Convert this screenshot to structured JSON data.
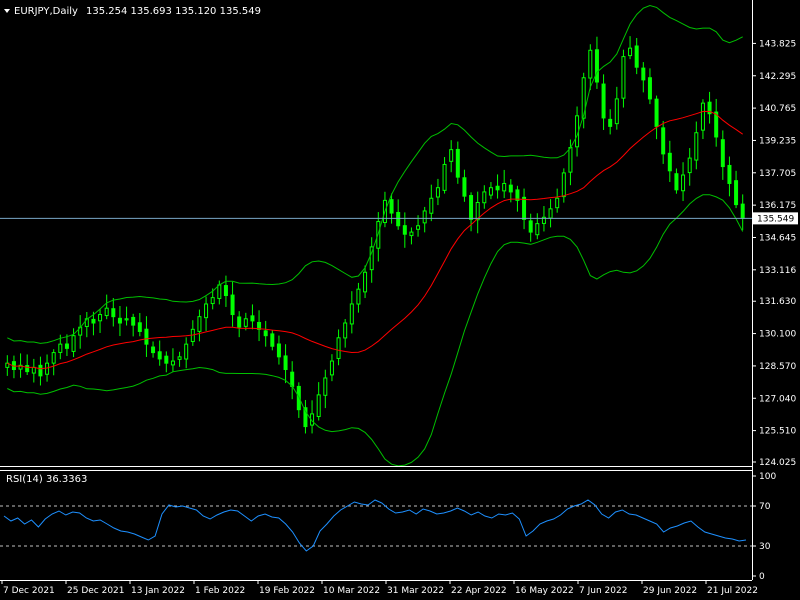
{
  "header": {
    "symbol": "EURJPY,Daily",
    "ohlc": "135.254 135.693 135.120 135.549"
  },
  "price_axis": {
    "ticks": [
      "143.825",
      "142.295",
      "140.765",
      "139.235",
      "137.705",
      "136.175",
      "134.645",
      "133.116",
      "131.630",
      "130.100",
      "128.570",
      "127.040",
      "125.510",
      "124.025"
    ],
    "current_price": "135.549"
  },
  "rsi": {
    "label": "RSI(14) 36.3363",
    "ticks": [
      "100",
      "70",
      "30",
      "0"
    ]
  },
  "time_axis": {
    "labels": [
      "7 Dec 2021",
      "25 Dec 2021",
      "13 Jan 2022",
      "1 Feb 2022",
      "19 Feb 2022",
      "10 Mar 2022",
      "31 Mar 2022",
      "22 Apr 2022",
      "16 May 2022",
      "7 Jun 2022",
      "29 Jun 2022",
      "21 Jul 2022"
    ]
  },
  "colors": {
    "background": "#000000",
    "candles": "#00ff00",
    "bands": "#00c000",
    "ma": "#ff0000",
    "rsi": "#1e90ff",
    "price_line": "#7aa7c7",
    "axis": "#ffffff"
  },
  "chart_data": {
    "type": "line",
    "title": "EURJPY,Daily",
    "series": [
      {
        "name": "EURJPY",
        "values": [
          128.7,
          128.4,
          128.6,
          128.3,
          128.5,
          128.1,
          128.7,
          129.2,
          129.6,
          129.4,
          130.0,
          130.4,
          130.8,
          130.6,
          131.0,
          131.3,
          130.9,
          130.6,
          130.8,
          130.5,
          130.2,
          129.6,
          129.2,
          128.9,
          128.7,
          128.8,
          129.0,
          129.6,
          130.3,
          130.9,
          131.5,
          131.8,
          132.4,
          131.9,
          131.0,
          130.4,
          130.8,
          130.7,
          130.3,
          130.0,
          129.5,
          129.0,
          128.4,
          127.6,
          126.5,
          125.7,
          126.3,
          127.2,
          128.0,
          128.8,
          129.9,
          130.6,
          131.5,
          132.2,
          133.0,
          134.2,
          135.4,
          136.4,
          135.8,
          135.2,
          134.8,
          134.9,
          135.2,
          135.9,
          136.5,
          137.0,
          138.1,
          138.8,
          137.5,
          136.6,
          135.5,
          136.3,
          136.8,
          137.0,
          136.9,
          137.2,
          136.8,
          136.4,
          135.5,
          134.9,
          135.3,
          135.6,
          136.0,
          136.5,
          137.7,
          138.9,
          140.4,
          142.2,
          143.5,
          142.0,
          140.3,
          139.9,
          141.2,
          143.2,
          143.6,
          142.7,
          142.1,
          141.2,
          139.9,
          138.6,
          137.8,
          136.9,
          137.6,
          138.4,
          139.6,
          141.0,
          140.5,
          139.4,
          138.0,
          137.2,
          136.2,
          135.549
        ],
        "color": "#00ff00"
      },
      {
        "name": "RSI(14)",
        "values": [
          60,
          55,
          58,
          52,
          56,
          49,
          57,
          62,
          65,
          61,
          64,
          63,
          58,
          55,
          56,
          52,
          48,
          45,
          44,
          42,
          39,
          36,
          40,
          62,
          71,
          69,
          70,
          68,
          66,
          60,
          57,
          61,
          64,
          66,
          65,
          60,
          55,
          60,
          62,
          59,
          58,
          52,
          44,
          33,
          25,
          30,
          45,
          52,
          60,
          66,
          70,
          74,
          72,
          71,
          76,
          73,
          67,
          63,
          64,
          66,
          62,
          67,
          65,
          62,
          63,
          65,
          68,
          65,
          61,
          64,
          60,
          58,
          62,
          61,
          63,
          57,
          40,
          45,
          52,
          55,
          57,
          61,
          67,
          70,
          72,
          76,
          71,
          62,
          58,
          64,
          66,
          62,
          61,
          58,
          55,
          52,
          44,
          48,
          50,
          53,
          55,
          49,
          44,
          42,
          40,
          38,
          37,
          35,
          36
        ],
        "color": "#1e90ff"
      }
    ],
    "x": [
      "7 Dec 2021",
      "25 Dec 2021",
      "13 Jan 2022",
      "1 Feb 2022",
      "19 Feb 2022",
      "10 Mar 2022",
      "31 Mar 2022",
      "22 Apr 2022",
      "16 May 2022",
      "7 Jun 2022",
      "29 Jun 2022",
      "21 Jul 2022"
    ],
    "ylim": [
      124.025,
      145.5
    ],
    "rsi_ylim": [
      0,
      100
    ],
    "rsi_levels": [
      70,
      30
    ]
  }
}
